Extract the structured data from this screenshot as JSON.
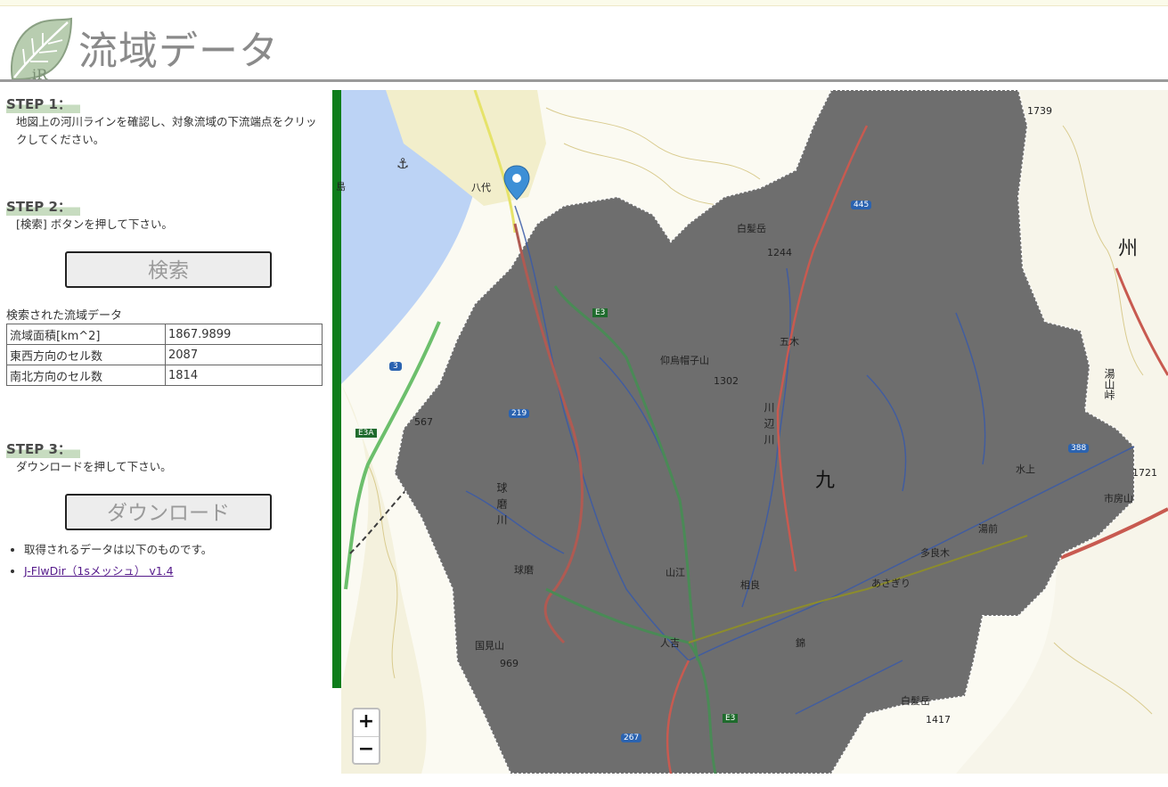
{
  "header": {
    "title": "流域データ",
    "logo_text": "iR"
  },
  "steps": [
    {
      "label": "STEP 1：",
      "description": "地図上の河川ラインを確認し、対象流域の下流端点をクリックしてください。"
    },
    {
      "label": "STEP 2：",
      "description": "[検索] ボタンを押して下さい。"
    },
    {
      "label": "STEP 3：",
      "description": "ダウンロードを押して下さい。"
    }
  ],
  "buttons": {
    "search": "検索",
    "download": "ダウンロード"
  },
  "results": {
    "caption": "検索された流域データ",
    "rows": [
      {
        "key": "流域面積[km^2]",
        "value": "1867.9899"
      },
      {
        "key": "東西方向のセル数",
        "value": "2087"
      },
      {
        "key": "南北方向のセル数",
        "value": "1814"
      }
    ]
  },
  "notes": {
    "intro": "取得されるデータは以下のものです。",
    "link": "J-FlwDir（1sメッシュ） v1.4"
  },
  "map": {
    "zoom_in": "+",
    "zoom_out": "−",
    "labels": {
      "yatsushiro": "八代",
      "shiragatake_n": "白髪岳",
      "peak_1244": "1244",
      "itsuki": "五木",
      "eboshiyama": "仰烏帽子山",
      "peak_1302": "1302",
      "peak_567": "567",
      "mizukami": "水上",
      "yunomae": "湯前",
      "taragi": "多良木",
      "asagiri": "あさぎり",
      "sagara": "相良",
      "yamae": "山江",
      "kuma": "球磨",
      "hitoyoshi": "人吉",
      "nishiki": "錦",
      "kunimiyama": "国見山",
      "peak_969": "969",
      "shiragatake_s": "白髪岳",
      "peak_1417": "1417",
      "peak_1721": "1721",
      "peak_1739": "1739",
      "ichifusayama": "市房山",
      "yunoyama_pass": "湯山峠",
      "kyushu": "州",
      "kyu": "九",
      "kawabegawa": "川辺川",
      "kumagawa": "球磨川",
      "shima": "島",
      "route_e3": "E3",
      "route_e3a": "E3A",
      "route_445": "445",
      "route_219": "219",
      "route_3": "3",
      "route_388": "388",
      "route_267": "267"
    }
  },
  "colors": {
    "basin_fill": "#6e6e6e",
    "river": "#3a5aa8",
    "road_red": "#c85a50",
    "sea": "#bcd3f5",
    "accent_green": "#0d7d1a",
    "marker": "#3d8fd6"
  }
}
